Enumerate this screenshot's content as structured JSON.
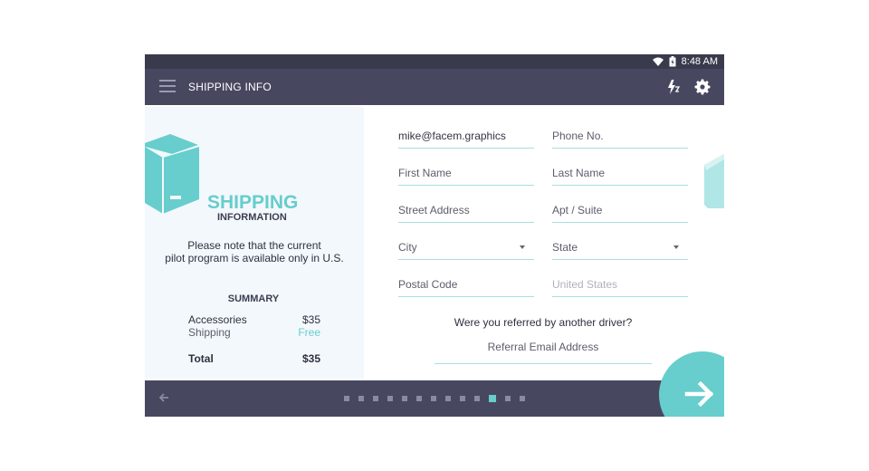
{
  "status_bar": {
    "time": "8:48 AM",
    "icons": [
      "wifi-icon",
      "battery-icon"
    ]
  },
  "app_bar": {
    "title": "SHIPPING INFO",
    "icons": [
      "menu-icon",
      "flash-icon",
      "settings-icon"
    ]
  },
  "left_panel": {
    "heading": "SHIPPING",
    "subheading": "INFORMATION",
    "note_line1": "Please note that the current",
    "note_line2": "pilot program is available only in U.S.",
    "summary": {
      "title": "SUMMARY",
      "rows": [
        {
          "label": "Accessories",
          "value": "$35"
        },
        {
          "label": "Shipping",
          "value": "Free"
        },
        {
          "label": "Total",
          "value": "$35"
        }
      ]
    }
  },
  "form": {
    "email": "mike@facem.graphics",
    "phone": "Phone No.",
    "first_name": "First Name",
    "last_name": "Last Name",
    "street": "Street Address",
    "apt": "Apt / Suite",
    "city": "City",
    "state": "State",
    "postal": "Postal Code",
    "country": "United States",
    "referral_question": "Were you referred by another driver?",
    "referral_placeholder": "Referral Email Address"
  },
  "pagination": {
    "total": 13,
    "current": 11
  },
  "colors": {
    "accent": "#67cdcd",
    "bar": "#474860",
    "status": "#393a4c",
    "panel": "#f3f8fc"
  }
}
